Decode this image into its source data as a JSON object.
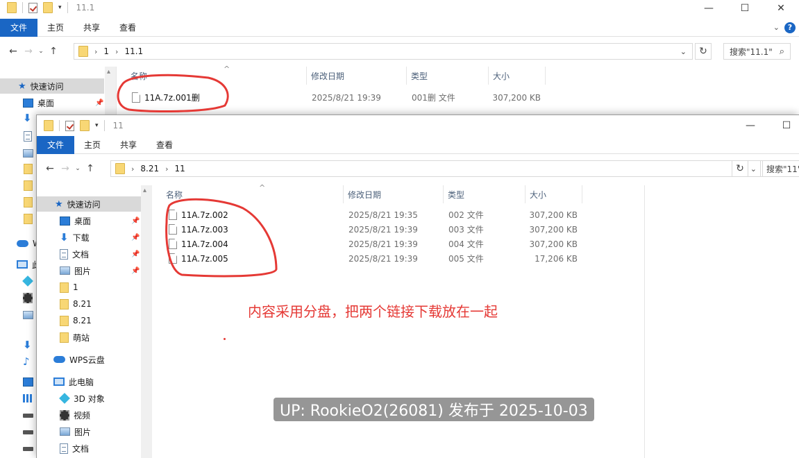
{
  "back_window": {
    "title": "11.1",
    "ribbon_tabs": [
      "文件",
      "主页",
      "共享",
      "查看"
    ],
    "breadcrumb": [
      "1",
      "11.1"
    ],
    "search_placeholder": "搜索\"11.1\"",
    "columns": {
      "name": "名称",
      "date": "修改日期",
      "type": "类型",
      "size": "大小"
    },
    "files": [
      {
        "name": "11A.7z.001删",
        "date": "2025/8/21 19:39",
        "type": "001删 文件",
        "size": "307,200 KB"
      }
    ],
    "sidebar": [
      {
        "label": "快速访问",
        "icon": "star-icon"
      },
      {
        "label": "桌面",
        "icon": "desktop-icon"
      }
    ]
  },
  "front_window": {
    "title": "11",
    "ribbon_tabs": [
      "文件",
      "主页",
      "共享",
      "查看"
    ],
    "breadcrumb": [
      "8.21",
      "11"
    ],
    "search_placeholder": "搜索\"11\"",
    "columns": {
      "name": "名称",
      "date": "修改日期",
      "type": "类型",
      "size": "大小"
    },
    "files": [
      {
        "name": "11A.7z.002",
        "date": "2025/8/21 19:35",
        "type": "002 文件",
        "size": "307,200 KB"
      },
      {
        "name": "11A.7z.003",
        "date": "2025/8/21 19:39",
        "type": "003 文件",
        "size": "307,200 KB"
      },
      {
        "name": "11A.7z.004",
        "date": "2025/8/21 19:39",
        "type": "004 文件",
        "size": "307,200 KB"
      },
      {
        "name": "11A.7z.005",
        "date": "2025/8/21 19:39",
        "type": "005 文件",
        "size": "17,206 KB"
      }
    ],
    "sidebar": [
      {
        "label": "快速访问",
        "icon": "star-icon"
      },
      {
        "label": "桌面",
        "icon": "desktop-icon"
      },
      {
        "label": "下载",
        "icon": "download-icon"
      },
      {
        "label": "文档",
        "icon": "document-icon"
      },
      {
        "label": "图片",
        "icon": "pictures-icon"
      },
      {
        "label": "1",
        "icon": "folder-icon"
      },
      {
        "label": "8.21",
        "icon": "folder-icon"
      },
      {
        "label": "8.21",
        "icon": "folder-icon"
      },
      {
        "label": "萌站",
        "icon": "folder-icon"
      },
      {
        "label": "WPS云盘",
        "icon": "cloud-icon"
      },
      {
        "label": "此电脑",
        "icon": "computer-icon"
      },
      {
        "label": "3D 对象",
        "icon": "3d-objects-icon"
      },
      {
        "label": "视频",
        "icon": "video-icon"
      },
      {
        "label": "图片",
        "icon": "pictures-icon"
      },
      {
        "label": "文档",
        "icon": "document-icon"
      }
    ]
  },
  "annotation_text": "内容采用分盘，把两个链接下载放在一起",
  "watermark": "UP: RookieO2(26081) 发布于 2025-10-03",
  "back_sidebar_partial": {
    "wps_initial": "W",
    "pc_initial": "此"
  },
  "colors": {
    "file_tab": "#1a66c4",
    "annotation_red": "#e53935",
    "folder_yellow": "#f8d775"
  }
}
